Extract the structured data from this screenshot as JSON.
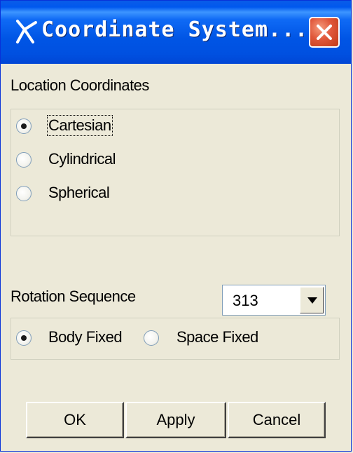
{
  "window": {
    "title": "Coordinate System..."
  },
  "location": {
    "label": "Location Coordinates",
    "options": [
      {
        "label": "Cartesian",
        "checked": true
      },
      {
        "label": "Cylindrical",
        "checked": false
      },
      {
        "label": "Spherical",
        "checked": false
      }
    ]
  },
  "rotation": {
    "label": "Rotation Sequence",
    "sequence_value": "313",
    "options": [
      {
        "label": "Body Fixed",
        "checked": true
      },
      {
        "label": "Space Fixed",
        "checked": false
      }
    ]
  },
  "buttons": {
    "ok": "OK",
    "apply": "Apply",
    "cancel": "Cancel"
  },
  "icons": {
    "app": "compass-icon",
    "close": "close-icon",
    "dropdown": "chevron-down-icon"
  },
  "colors": {
    "titlebar": "#0055E5",
    "close": "#E0573A",
    "face": "#ECE9D8"
  }
}
